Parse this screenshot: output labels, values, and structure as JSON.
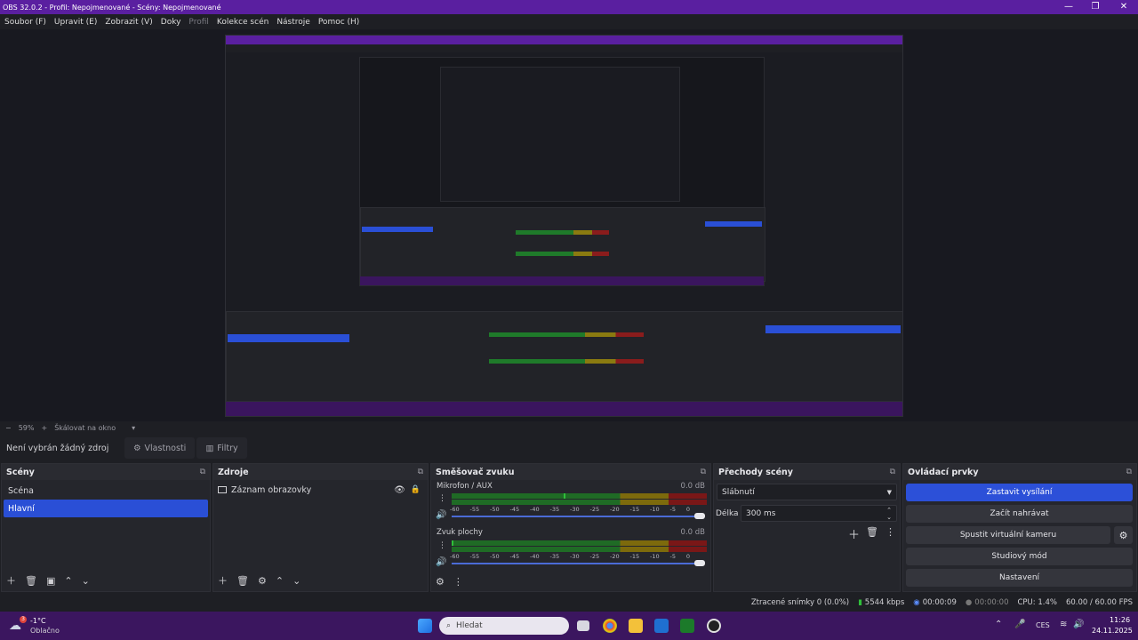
{
  "window": {
    "title": "OBS 32.0.2 - Profil: Nepojmenované - Scény: Nepojmenované",
    "minimize": "—",
    "restore": "❐",
    "close": "✕"
  },
  "menu": [
    "Soubor (F)",
    "Upravit (E)",
    "Zobrazit (V)",
    "Doky",
    "Profil",
    "Kolekce scén",
    "Nástroje",
    "Pomoc (H)"
  ],
  "scale": {
    "minus": "−",
    "zoom": "59%",
    "plus": "+",
    "mode": "Škálovat na okno",
    "arrow": "▾"
  },
  "sourcebar": {
    "no_source": "Není vybrán žádný zdroj",
    "properties": "Vlastnosti",
    "filters": "Filtry"
  },
  "scenes": {
    "title": "Scény",
    "items": [
      {
        "label": "Scéna",
        "selected": false
      },
      {
        "label": "Hlavní",
        "selected": true
      }
    ]
  },
  "sources": {
    "title": "Zdroje",
    "items": [
      {
        "label": "Záznam obrazovky",
        "visible": true,
        "locked": true
      }
    ]
  },
  "mixer": {
    "title": "Směšovač zvuku",
    "ticks": [
      "-60",
      "-55",
      "-50",
      "-45",
      "-40",
      "-35",
      "-30",
      "-25",
      "-20",
      "-15",
      "-10",
      "-5",
      "0"
    ],
    "channels": [
      {
        "name": "Mikrofon / AUX",
        "db": "0.0 dB",
        "level": 0.44
      },
      {
        "name": "Zvuk plochy",
        "db": "0.0 dB",
        "level": 0.0
      }
    ]
  },
  "transitions": {
    "title": "Přechody scény",
    "selected": "Slábnutí",
    "duration_label": "Délka",
    "duration_value": "300 ms"
  },
  "controls": {
    "title": "Ovládací prvky",
    "buttons": [
      "Zastavit vysílání",
      "Začít nahrávat",
      "Spustit virtuální kameru",
      "Studiový mód",
      "Nastavení"
    ]
  },
  "status": {
    "dropped": "Ztracené snímky 0 (0.0%)",
    "bitrate": "5544 kbps",
    "stream_time": "00:00:09",
    "rec_time": "00:00:00",
    "cpu": "CPU: 1.4%",
    "fps": "60.00 / 60.00 FPS"
  },
  "taskbar": {
    "weather_temp": "-1°C",
    "weather_desc": "Oblačno",
    "weather_badge": "3",
    "search": "Hledat",
    "lang": "CES",
    "time": "11:26",
    "date": "24.11.2025"
  },
  "colors": {
    "titlebar": "#5a1fa0",
    "accent": "#2c50d8",
    "taskbar": "#3b165f"
  }
}
